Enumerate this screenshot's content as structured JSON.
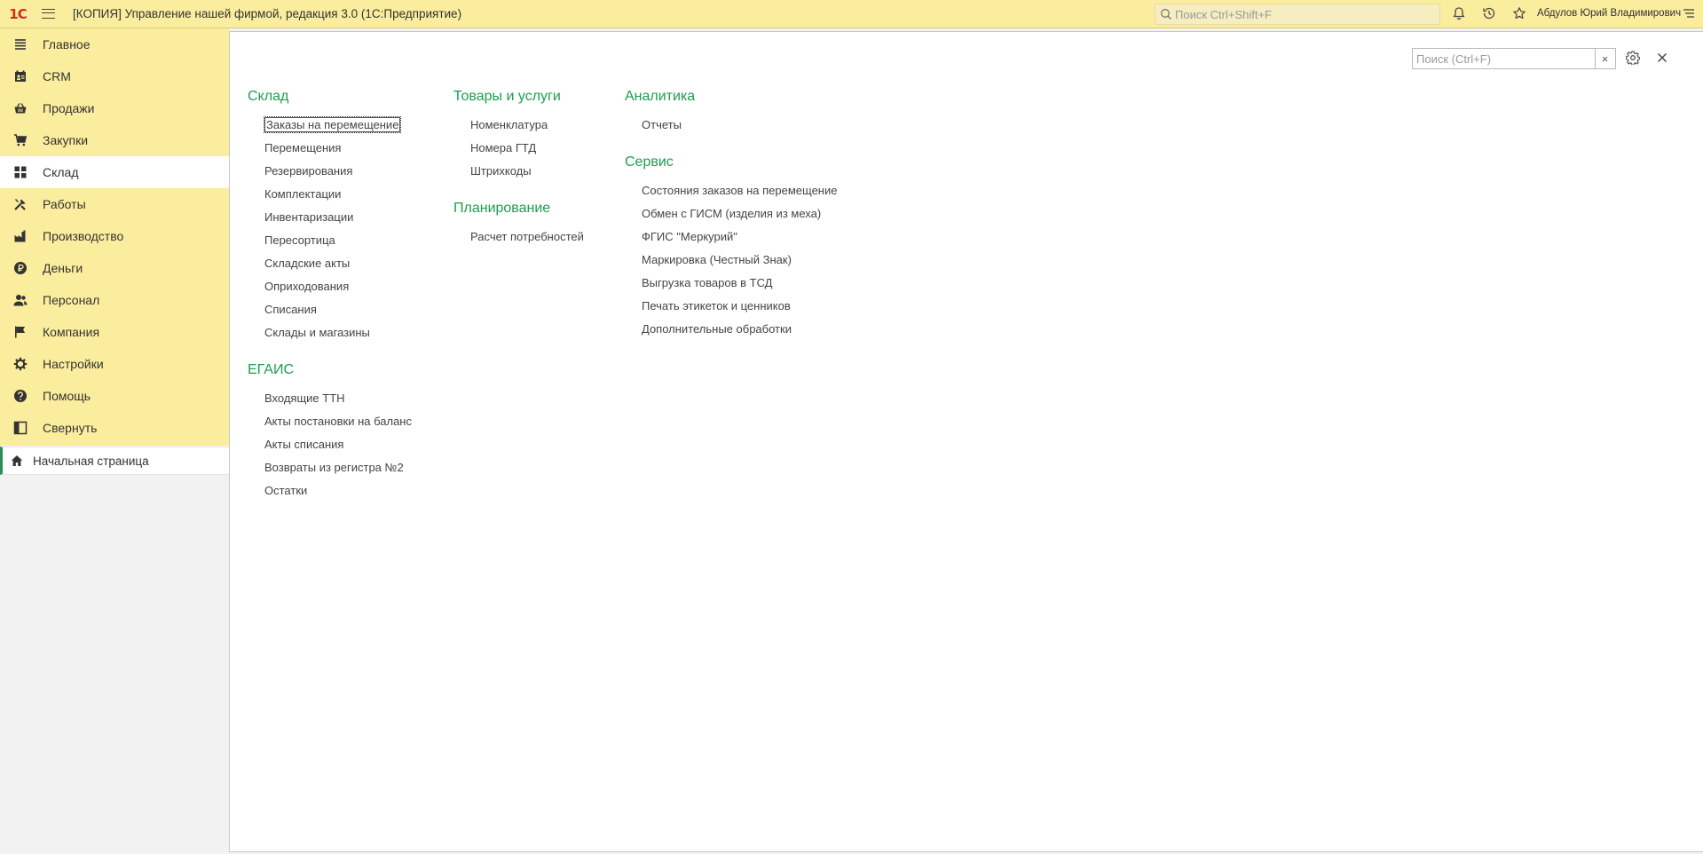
{
  "app": {
    "logo": "1С",
    "title": "[КОПИЯ] Управление нашей фирмой, редакция 3.0  (1С:Предприятие)",
    "search_placeholder": "Поиск Ctrl+Shift+F",
    "user": "Абдулов Юрий Владимирович"
  },
  "sidebar": {
    "items": [
      {
        "label": "Главное",
        "icon": "menu-lines-icon"
      },
      {
        "label": "CRM",
        "icon": "contact-card-icon"
      },
      {
        "label": "Продажи",
        "icon": "basket-icon"
      },
      {
        "label": "Закупки",
        "icon": "cart-icon"
      },
      {
        "label": "Склад",
        "icon": "warehouse-grid-icon"
      },
      {
        "label": "Работы",
        "icon": "tools-icon"
      },
      {
        "label": "Производство",
        "icon": "factory-icon"
      },
      {
        "label": "Деньги",
        "icon": "ruble-coin-icon"
      },
      {
        "label": "Персонал",
        "icon": "people-icon"
      },
      {
        "label": "Компания",
        "icon": "flag-icon"
      },
      {
        "label": "Настройки",
        "icon": "gear-icon"
      },
      {
        "label": "Помощь",
        "icon": "help-icon"
      },
      {
        "label": "Свернуть",
        "icon": "collapse-panel-icon"
      }
    ],
    "active": "Склад",
    "home_tab": "Начальная страница"
  },
  "panel": {
    "search_placeholder": "Поиск (Ctrl+F)",
    "clear": "×",
    "sections": {
      "sklad": {
        "title": "Склад",
        "items": [
          "Заказы на перемещение",
          "Перемещения",
          "Резервирования",
          "Комплектации",
          "Инвентаризации",
          "Пересортица",
          "Складские акты",
          "Оприходования",
          "Списания",
          "Склады и магазины"
        ]
      },
      "egais": {
        "title": "ЕГАИС",
        "items": [
          "Входящие ТТН",
          "Акты постановки на баланс",
          "Акты списания",
          "Возвраты из регистра №2",
          "Остатки"
        ]
      },
      "goods": {
        "title": "Товары и услуги",
        "items": [
          "Номенклатура",
          "Номера ГТД",
          "Штрихкоды"
        ]
      },
      "planning": {
        "title": "Планирование",
        "items": [
          "Расчет потребностей"
        ]
      },
      "analytics": {
        "title": "Аналитика",
        "items": [
          "Отчеты"
        ]
      },
      "service": {
        "title": "Сервис",
        "items": [
          "Состояния заказов на перемещение",
          "Обмен с ГИСМ (изделия из меха)",
          "ФГИС \"Меркурий\"",
          "Маркировка (Честный Знак)",
          "Выгрузка товаров в ТСД",
          "Печать этикеток и ценников",
          "Дополнительные обработки"
        ]
      }
    }
  },
  "colors": {
    "accent_yellow": "#fbed9e",
    "section_green": "#1f9c4f",
    "logo_red": "#d52b1e"
  }
}
